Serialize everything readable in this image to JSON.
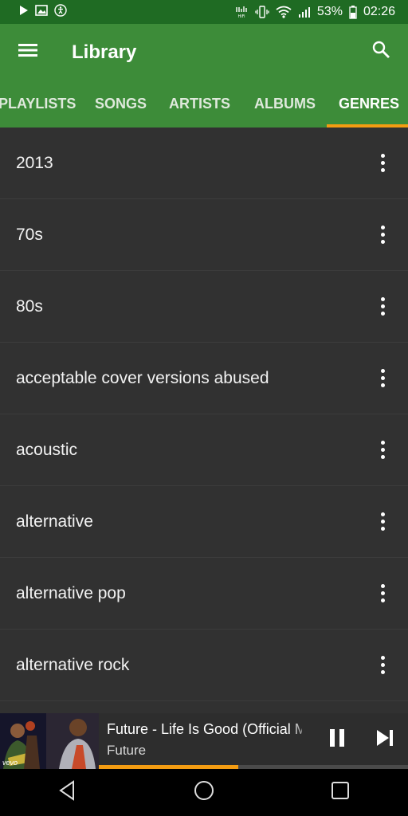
{
  "status_bar": {
    "battery": "53%",
    "time": "02:26",
    "icons": [
      "play-icon",
      "image-icon",
      "accessibility-icon",
      "hifi-icon",
      "vibrate-icon",
      "wifi-icon",
      "signal-icon",
      "battery-icon"
    ]
  },
  "app_bar": {
    "title": "Library",
    "menu_icon": "menu-icon",
    "search_icon": "search-icon"
  },
  "tabs": [
    {
      "label": "PLAYLISTS"
    },
    {
      "label": "SONGS"
    },
    {
      "label": "ARTISTS"
    },
    {
      "label": "ALBUMS"
    },
    {
      "label": "GENRES",
      "active": true
    }
  ],
  "genres": [
    {
      "name": "2013"
    },
    {
      "name": "70s"
    },
    {
      "name": "80s"
    },
    {
      "name": "acceptable cover versions abused"
    },
    {
      "name": "acoustic"
    },
    {
      "name": "alternative"
    },
    {
      "name": "alternative pop"
    },
    {
      "name": "alternative rock"
    }
  ],
  "now_playing": {
    "title": "Future - Life Is Good (Official Music Video)",
    "artist": "Future",
    "art_watermark": "vevo",
    "progress": 0.45,
    "icons": [
      "pause-icon",
      "skip-next-icon"
    ]
  },
  "colors": {
    "status_bar": "#1f6b23",
    "app_bar": "#3d8c39",
    "accent": "#f39c12",
    "list_background": "#313131"
  }
}
